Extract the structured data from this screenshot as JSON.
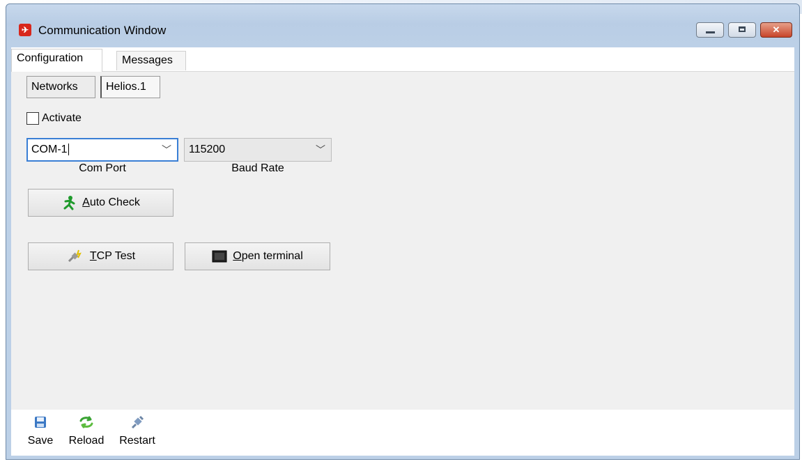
{
  "window": {
    "title": "Communication Window",
    "icons": {
      "app": "app-rocket-icon"
    },
    "caption_buttons": {
      "minimize": "minimize-icon",
      "maximize": "maximize-icon",
      "close": "close-icon"
    }
  },
  "tabs": [
    {
      "label": "Configuration",
      "active": true
    },
    {
      "label": "Messages",
      "active": false
    }
  ],
  "subtabs": [
    {
      "label": "Networks",
      "active": false
    },
    {
      "label": "Helios.1",
      "active": true
    }
  ],
  "activate": {
    "label": "Activate",
    "checked": false
  },
  "com_port": {
    "value": "COM-1",
    "caption": "Com Port"
  },
  "baud_rate": {
    "value": "115200",
    "caption": "Baud Rate"
  },
  "buttons": {
    "auto_check": {
      "label_prefix": "",
      "mnemonic": "A",
      "label_rest": "uto Check",
      "icon": "running-man-icon"
    },
    "tcp_test": {
      "mnemonic": "T",
      "label_rest": "CP Test",
      "icon": "plug-icon"
    },
    "open_terminal": {
      "mnemonic": "O",
      "label_rest": "pen terminal",
      "icon": "terminal-icon"
    }
  },
  "toolbar": [
    {
      "label": "Save",
      "icon": "floppy-disk-icon"
    },
    {
      "label": "Reload",
      "icon": "refresh-icon"
    },
    {
      "label": "Restart",
      "icon": "plug-restart-icon"
    }
  ],
  "colors": {
    "accent": "#3a7fd5",
    "titlebar": "#bcd0e7",
    "close": "#c8452a",
    "panel": "#f0f0f0"
  }
}
